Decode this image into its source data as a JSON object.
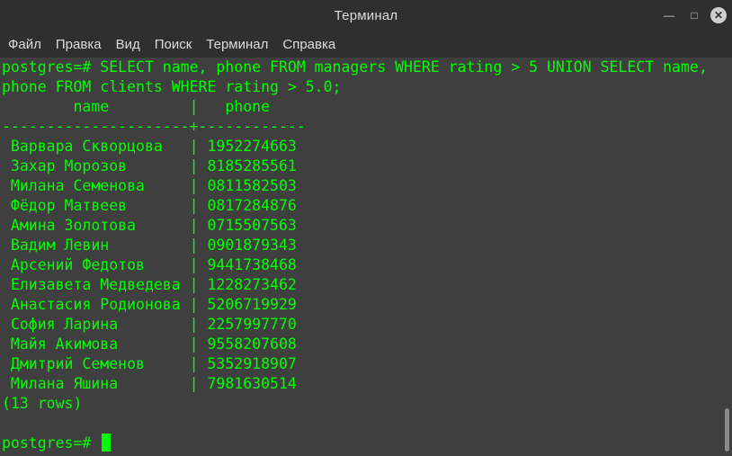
{
  "window": {
    "title": "Терминал"
  },
  "menu": [
    "Файл",
    "Правка",
    "Вид",
    "Поиск",
    "Терминал",
    "Справка"
  ],
  "terminal": {
    "lines": [
      "postgres=# SELECT name, phone FROM managers WHERE rating > 5 UNION SELECT name,",
      "phone FROM clients WHERE rating > 5.0;",
      "        name         |   phone",
      "---------------------+------------",
      " Варвара Скворцова   | 1952274663",
      " Захар Морозов       | 8185285561",
      " Милана Семенова     | 0811582503",
      " Фёдор Матвеев       | 0817284876",
      " Амина Золотова      | 0715507563",
      " Вадим Левин         | 0901879343",
      " Арсений Федотов     | 9441738468",
      " Елизавета Медведева | 1228273462",
      " Анастасия Родионова | 5206719929",
      " София Ларина        | 2257997770",
      " Майя Акимова        | 9558207608",
      " Дмитрий Семенов     | 5352918907",
      " Милана Яшина        | 7981630514",
      "(13 rows)",
      "",
      "postgres=# "
    ]
  }
}
